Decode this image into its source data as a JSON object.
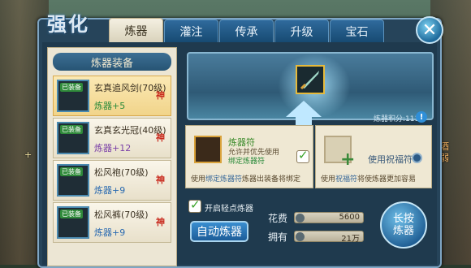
{
  "title": "强化",
  "tabs": [
    {
      "label": "炼器",
      "active": true
    },
    {
      "label": "灌注",
      "active": false
    },
    {
      "label": "传承",
      "active": false
    },
    {
      "label": "升级",
      "active": false
    },
    {
      "label": "宝石",
      "active": false
    }
  ],
  "left_panel": {
    "header": "炼器装备",
    "items": [
      {
        "name": "玄真追风剑(70级)",
        "bonus": "炼器+5",
        "badge": "已装备",
        "equip": "神",
        "selected": true
      },
      {
        "name": "玄真玄光冠(40级)",
        "bonus": "炼器+12",
        "badge": "已装备",
        "equip": "神",
        "selected": false
      },
      {
        "name": "松风袍(70级)",
        "bonus": "炼器+9",
        "badge": "已装备",
        "equip": "神",
        "selected": false
      },
      {
        "name": "松风裤(70级)",
        "bonus": "炼器+9",
        "badge": "已装备",
        "equip": "神",
        "selected": false
      }
    ]
  },
  "score_label": "炼器积分:1114",
  "option_a": {
    "name": "炼器符",
    "desc_line1": "允许并优先使用",
    "desc_line2": "绑定炼器符",
    "tip_prefix": "使用",
    "tip_highlight": "绑定炼器符",
    "tip_suffix": "炼器出装备将绑定",
    "checked": true
  },
  "option_b": {
    "label": "使用祝福符",
    "tip_prefix": "使用",
    "tip_highlight": "祝福符",
    "tip_suffix": "将使炼器更加容易",
    "checked": false
  },
  "light_refine_label": "开启轻点炼器",
  "auto_button": "自动炼器",
  "cost_label": "花费",
  "cost_value": "5600",
  "owned_label": "拥有",
  "owned_value": "21万",
  "hold_button": "长按炼器",
  "side_text_left": "+",
  "side_text_right_1": "酒",
  "side_text_right_2": "弱",
  "colors": {
    "bonus": "#2a8a3a",
    "bonus_alt": "#7a3fa8",
    "bonus_blue": "#2a6ab0",
    "panel": "#26445a"
  }
}
